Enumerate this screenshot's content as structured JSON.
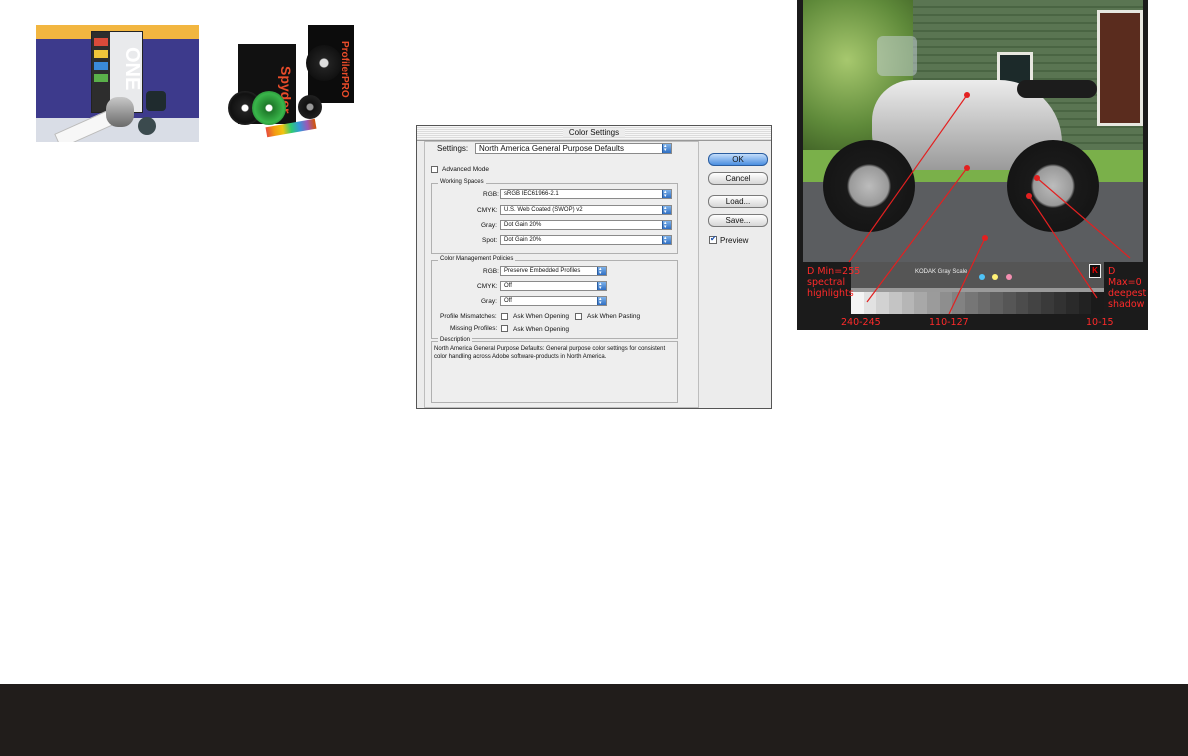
{
  "products": {
    "left_name": "ONE",
    "right_name": "Spyder",
    "right_case_text": "ProfilerPRO"
  },
  "dialog": {
    "title": "Color Settings",
    "settings_label": "Settings:",
    "settings_value": "North America General Purpose Defaults",
    "advanced_mode": "Advanced Mode",
    "working_spaces": {
      "title": "Working Spaces",
      "rows": [
        {
          "label": "RGB:",
          "value": "sRGB IEC61966-2.1"
        },
        {
          "label": "CMYK:",
          "value": "U.S. Web Coated (SWOP) v2"
        },
        {
          "label": "Gray:",
          "value": "Dot Gain 20%"
        },
        {
          "label": "Spot:",
          "value": "Dot Gain 20%"
        }
      ]
    },
    "policies": {
      "title": "Color Management Policies",
      "rows": [
        {
          "label": "RGB:",
          "value": "Preserve Embedded Profiles"
        },
        {
          "label": "CMYK:",
          "value": "Off"
        },
        {
          "label": "Gray:",
          "value": "Off"
        }
      ],
      "profile_mismatches_label": "Profile Mismatches:",
      "ask_when_opening": "Ask When Opening",
      "ask_when_pasting": "Ask When Pasting",
      "missing_profiles_label": "Missing Profiles:",
      "missing_ask_when_opening": "Ask When Opening"
    },
    "description": {
      "title": "Description",
      "text": "North America General Purpose Defaults:  General purpose color settings for consistent color handling across Adobe software-products in North America."
    },
    "buttons": {
      "ok": "OK",
      "cancel": "Cancel",
      "load": "Load...",
      "save": "Save..."
    },
    "preview_label": "Preview",
    "preview_checked": true
  },
  "photo": {
    "scale_title": "KODAK Gray Scale",
    "labels": {
      "dmin_line1": "D Min=255",
      "dmin_line2": "spectral",
      "dmin_line3": "highlights",
      "dmax_line1": "D Max=0",
      "dmax_line2": "deepest",
      "dmax_line3": "shadow",
      "val_left": "240-245",
      "val_mid": "110-127",
      "val_right": "10-15"
    },
    "annotation_color": "#ff2a2a"
  },
  "colors": {
    "footer": "#211d1b",
    "dialog_default_button": "#4a8ee0"
  }
}
